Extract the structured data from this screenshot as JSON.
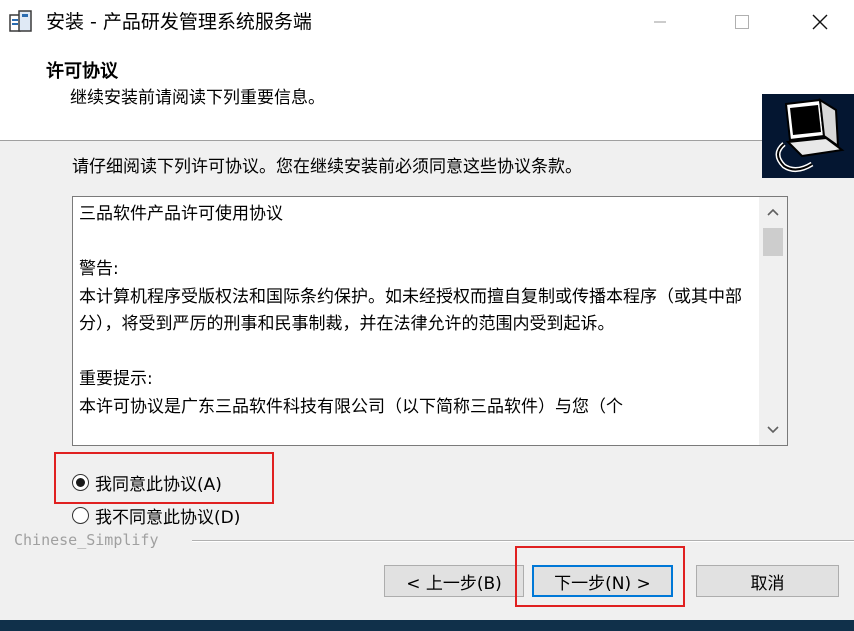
{
  "window": {
    "title": "安装 - 产品研发管理系统服务端",
    "icons": {
      "app": "installer-icon",
      "minimize": "minimize-icon",
      "maximize": "maximize-icon",
      "close": "close-icon"
    }
  },
  "header": {
    "title": "许可协议",
    "subtitle": "继续安装前请阅读下列重要信息。",
    "image": "computer-install-icon"
  },
  "main": {
    "intro": "请仔细阅读下列许可协议。您在继续安装前必须同意这些协议条款。",
    "license_text": "三品软件产品许可使用协议\n\n警告:\n本计算机程序受版权法和国际条约保护。如未经授权而擅自复制或传播本程序（或其中部分），将受到严厉的刑事和民事制裁，并在法律允许的范围内受到起诉。\n\n重要提示:\n本许可协议是广东三品软件科技有限公司（以下简称三品软件）与您（个",
    "accept_label": "我同意此协议(A)",
    "decline_label": "我不同意此协议(D)",
    "selected": "accept"
  },
  "footer": {
    "language": "Chinese_Simplify",
    "back_label": "< 上一步(B)",
    "next_label": "下一步(N) >",
    "cancel_label": "取消"
  },
  "colors": {
    "highlight": "#e02020",
    "focus": "#0078d7",
    "header_image_bg": "#041631"
  }
}
